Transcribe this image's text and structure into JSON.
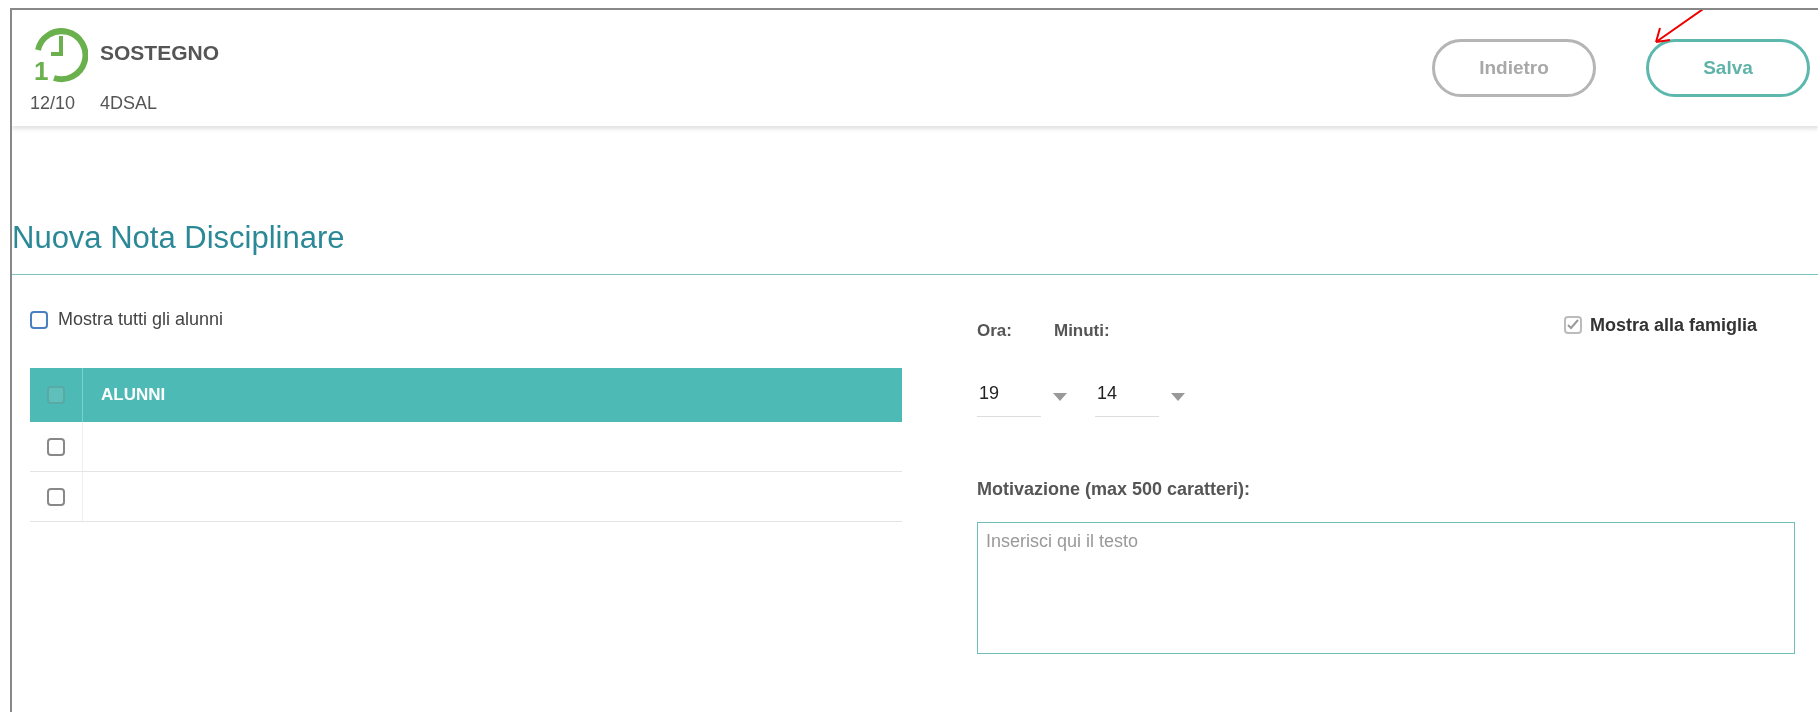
{
  "header": {
    "period": "1",
    "subject": "SOSTEGNO",
    "date": "12/10",
    "class": "4DSAL",
    "buttons": [
      {
        "label": "Indietro",
        "kind": "secondary"
      },
      {
        "label": "Salva",
        "kind": "primary"
      }
    ]
  },
  "title": "Nuova Nota Disciplinare",
  "show_all": {
    "label": "Mostra tutti gli alunni",
    "checked": false
  },
  "table": {
    "header_checked": false,
    "column": "ALUNNI",
    "rows": [
      {
        "checked": false
      },
      {
        "checked": false
      }
    ]
  },
  "time": {
    "hour_label": "Ora:",
    "minute_label": "Minuti:",
    "hour": "19",
    "minute": "14"
  },
  "show_family": {
    "label": "Mostra alla famiglia",
    "checked": true
  },
  "reason": {
    "label": "Motivazione (max 500 caratteri):",
    "placeholder": "Inserisci qui il testo"
  }
}
